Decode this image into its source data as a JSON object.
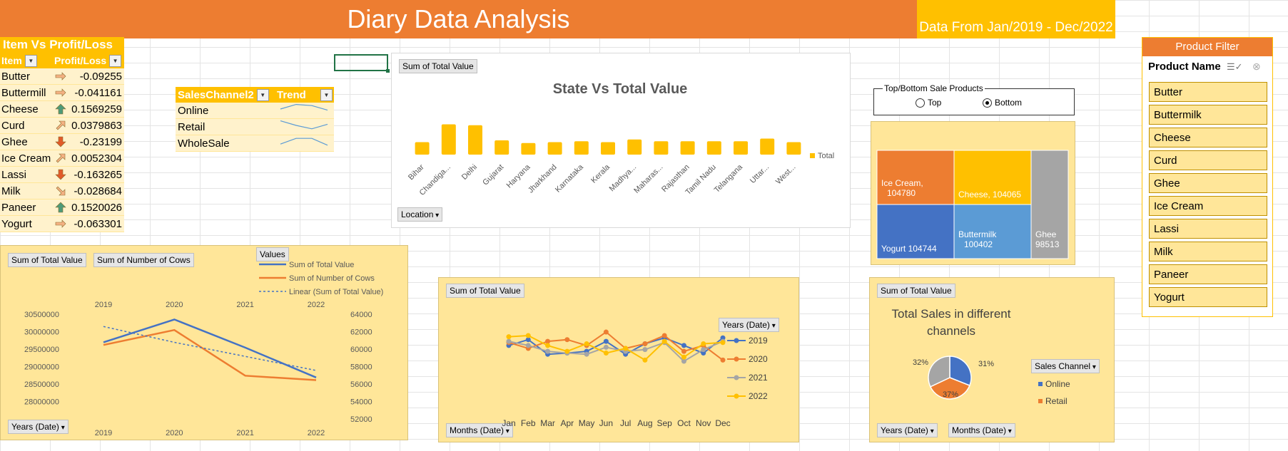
{
  "title": "Diary Data Analysis",
  "date_range": "Data From Jan/2019 - Dec/2022",
  "item_profit": {
    "header": "Item Vs Profit/Loss",
    "col_item": "Item",
    "col_value": "Profit/Loss",
    "rows": [
      {
        "item": "Butter",
        "value": "-0.09255",
        "icon": "sideways-arrow-icon"
      },
      {
        "item": "Buttermill",
        "value": "-0.041161",
        "icon": "sideways-arrow-icon"
      },
      {
        "item": "Cheese",
        "value": "0.1569259",
        "icon": "up-arrow-icon"
      },
      {
        "item": "Curd",
        "value": "0.0379863",
        "icon": "up-right-arrow-icon"
      },
      {
        "item": "Ghee",
        "value": "-0.23199",
        "icon": "down-arrow-icon"
      },
      {
        "item": "Ice Cream",
        "value": "0.0052304",
        "icon": "up-right-arrow-icon"
      },
      {
        "item": "Lassi",
        "value": "-0.163265",
        "icon": "down-arrow-icon"
      },
      {
        "item": "Milk",
        "value": "-0.028684",
        "icon": "down-right-arrow-icon"
      },
      {
        "item": "Paneer",
        "value": "0.1520026",
        "icon": "up-arrow-icon"
      },
      {
        "item": "Yogurt",
        "value": "-0.063301",
        "icon": "sideways-arrow-icon"
      }
    ]
  },
  "sales_channel": {
    "col1": "SalesChannel2",
    "col2": "Trend",
    "rows": [
      {
        "name": "Online",
        "trend": [
          0.5,
          0.9,
          0.8,
          0.4
        ]
      },
      {
        "name": "Retail",
        "trend": [
          0.9,
          0.5,
          0.2,
          0.6
        ]
      },
      {
        "name": "WholeSale",
        "trend": [
          0.3,
          0.8,
          0.8,
          0.2
        ]
      }
    ]
  },
  "state_chart": {
    "field_label": "Sum of Total Value",
    "filter_label": "Location",
    "legend": "Total",
    "chart_data": {
      "type": "bar",
      "title": "State Vs Total Value",
      "categories": [
        "Bihar",
        "Chandiga...",
        "Delhi",
        "Gujarat",
        "Haryana",
        "Jharkhand",
        "Karnataka",
        "Kerala",
        "Madhya...",
        "Maharas...",
        "Rajasthan",
        "Tamil Nadu",
        "Telangana",
        "Uttar...",
        "West..."
      ],
      "values": [
        14,
        34,
        33,
        16,
        13,
        14,
        15,
        14,
        17,
        15,
        15,
        15,
        15,
        18,
        14
      ],
      "color": "#FFC000"
    }
  },
  "top_bottom": {
    "group_label": "Top/Bottom Sale Products",
    "option_top": "Top",
    "option_bottom": "Bottom",
    "selected": "Bottom"
  },
  "treemap": {
    "chart_data": {
      "type": "treemap",
      "items": [
        {
          "label": "Ice Cream,",
          "label2": "104780",
          "value": 104780,
          "color": "#ED7D31"
        },
        {
          "label": "Cheese, 104065",
          "label2": "",
          "value": 104065,
          "color": "#FFC000"
        },
        {
          "label": "Ghee",
          "label2": "98513",
          "value": 98513,
          "color": "#A5A5A5"
        },
        {
          "label": "Yogurt 104744",
          "label2": "",
          "value": 104744,
          "color": "#4472C4"
        },
        {
          "label": "Buttermilk",
          "label2": "100402",
          "value": 100402,
          "color": "#5B9BD5"
        }
      ]
    }
  },
  "product_filter": {
    "title": "Product Filter",
    "field": "Product Name",
    "items": [
      "Butter",
      "Buttermilk",
      "Cheese",
      "Curd",
      "Ghee",
      "Ice Cream",
      "Lassi",
      "Milk",
      "Paneer",
      "Yogurt"
    ]
  },
  "years_chart": {
    "chip1": "Sum of Total Value",
    "chip2": "Sum of Number of Cows",
    "values_label": "Values",
    "filter_label": "Years (Date)",
    "chart_data": {
      "type": "line",
      "categories": [
        "2019",
        "2020",
        "2021",
        "2022"
      ],
      "series": [
        {
          "name": "Sum of Total Value",
          "values": [
            29700000,
            30350000,
            29550000,
            28700000
          ],
          "color": "#4472C4",
          "axis": "left"
        },
        {
          "name": "Sum of Number of Cows",
          "values": [
            60500,
            62200,
            57000,
            56500
          ],
          "color": "#ED7D31",
          "axis": "right"
        },
        {
          "name": "Linear (Sum of Total Value)",
          "values": [
            30150000,
            29700000,
            29300000,
            28900000
          ],
          "color": "#4472C4",
          "axis": "left",
          "dashed": true
        }
      ],
      "y_left_ticks": [
        "30500000",
        "30000000",
        "29500000",
        "29000000",
        "28500000",
        "28000000"
      ],
      "y_right_ticks": [
        "64000",
        "62000",
        "60000",
        "58000",
        "56000",
        "54000",
        "52000"
      ],
      "ylim_left": [
        27500000,
        30500000
      ],
      "ylim_right": [
        52000,
        64000
      ]
    }
  },
  "months_chart": {
    "field_label": "Sum of Total Value",
    "legend_title": "Years (Date)",
    "filter_label": "Months (Date)",
    "chart_data": {
      "type": "line",
      "categories": [
        "Jan",
        "Feb",
        "Mar",
        "Apr",
        "May",
        "Jun",
        "Jul",
        "Aug",
        "Sep",
        "Oct",
        "Nov",
        "Dec"
      ],
      "series": [
        {
          "name": "2019",
          "color": "#4472C4",
          "values": [
            0.55,
            0.65,
            0.4,
            0.42,
            0.45,
            0.62,
            0.4,
            0.58,
            0.68,
            0.55,
            0.42,
            0.68
          ]
        },
        {
          "name": "2020",
          "color": "#ED7D31",
          "values": [
            0.6,
            0.5,
            0.62,
            0.65,
            0.55,
            0.78,
            0.5,
            0.58,
            0.72,
            0.45,
            0.55,
            0.3
          ]
        },
        {
          "name": "2021",
          "color": "#A5A5A5",
          "values": [
            0.62,
            0.55,
            0.45,
            0.42,
            0.4,
            0.52,
            0.45,
            0.48,
            0.6,
            0.28,
            0.48,
            0.62
          ]
        },
        {
          "name": "2022",
          "color": "#FFC000",
          "values": [
            0.7,
            0.72,
            0.55,
            0.45,
            0.58,
            0.42,
            0.5,
            0.3,
            0.62,
            0.35,
            0.58,
            0.6
          ]
        }
      ]
    }
  },
  "channels_chart": {
    "field_label": "Sum of Total Value",
    "legend_title": "Sales Channel",
    "filter_years": "Years (Date)",
    "filter_months": "Months (Date)",
    "chart_data": {
      "type": "pie",
      "title_line1": "Total Sales in different",
      "title_line2": "channels",
      "slices": [
        {
          "name": "Online",
          "value": 31,
          "label": "31%",
          "color": "#4472C4"
        },
        {
          "name": "Retail",
          "value": 37,
          "label": "37%",
          "color": "#ED7D31"
        },
        {
          "name": "",
          "value": 32,
          "label": "32%",
          "color": "#A5A5A5"
        }
      ],
      "legend": [
        "Online",
        "Retail"
      ]
    }
  }
}
